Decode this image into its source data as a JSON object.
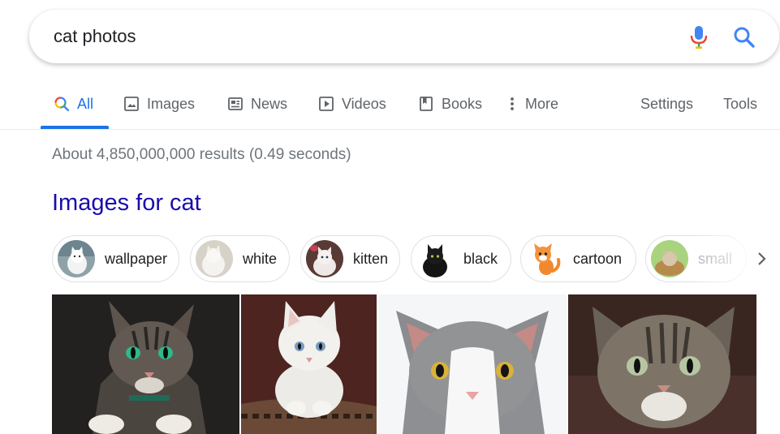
{
  "search": {
    "query": "cat photos",
    "mic_icon": "microphone-icon",
    "search_icon": "magnifier-icon"
  },
  "tabs": [
    {
      "label": "All",
      "icon": "search-multicolor-icon",
      "active": true
    },
    {
      "label": "Images",
      "icon": "image-icon"
    },
    {
      "label": "News",
      "icon": "newspaper-icon"
    },
    {
      "label": "Videos",
      "icon": "play-icon"
    },
    {
      "label": "Books",
      "icon": "bookmark-icon"
    },
    {
      "label": "More",
      "icon": "vertical-dots-icon"
    }
  ],
  "tools": {
    "settings": "Settings",
    "tools": "Tools"
  },
  "result_stats": "About 4,850,000,000 results (0.49 seconds)",
  "images_section": {
    "title": "Images for cat",
    "chips": [
      {
        "label": "wallpaper"
      },
      {
        "label": "white"
      },
      {
        "label": "kitten"
      },
      {
        "label": "black"
      },
      {
        "label": "cartoon"
      },
      {
        "label": "small"
      }
    ],
    "next_icon": "chevron-right-icon"
  },
  "colors": {
    "accent": "#1a73e8",
    "link": "#1a0dab",
    "muted": "#70757a",
    "google_blue": "#4285f4",
    "google_red": "#ea4335",
    "google_yellow": "#fbbc05",
    "google_green": "#34a853"
  }
}
